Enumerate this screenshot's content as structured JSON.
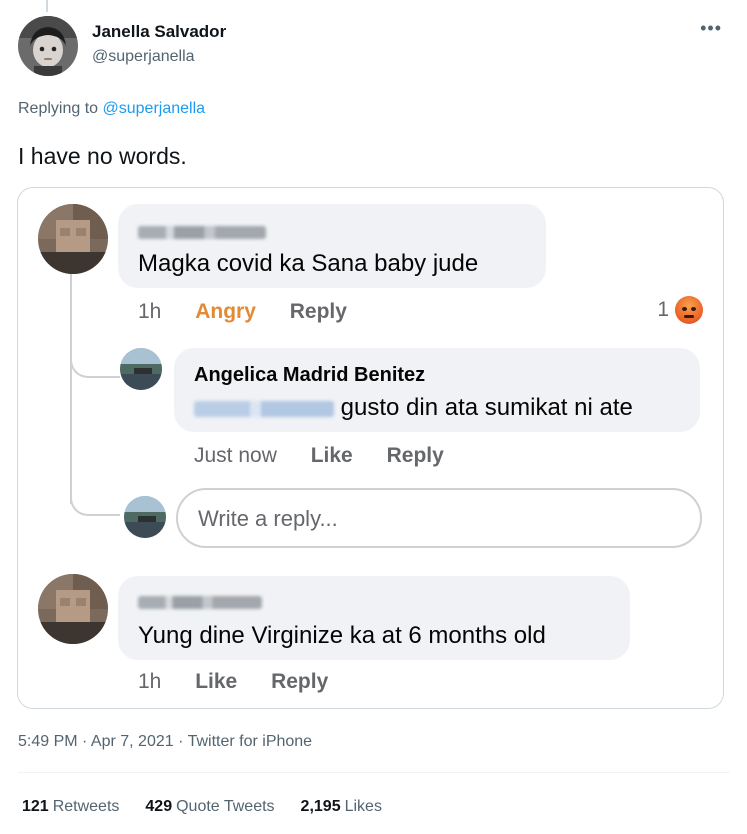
{
  "tweet": {
    "author_name": "Janella Salvador",
    "author_handle": "@superjanella",
    "more_icon": "more-icon",
    "replying_prefix": "Replying to",
    "replying_handle": "@superjanella",
    "text": "I have no words.",
    "timestamp": "5:49 PM · Apr 7, 2021 · Twitter for iPhone",
    "stats": {
      "retweets_count": "121",
      "retweets_label": "Retweets",
      "quote_count": "429",
      "quote_label": "Quote Tweets",
      "likes_count": "2,195",
      "likes_label": "Likes"
    }
  },
  "embedded": {
    "comment1": {
      "text": "Magka covid ka Sana baby jude",
      "time": "1h",
      "reaction": "Angry",
      "reply": "Reply",
      "reaction_count": "1"
    },
    "reply1": {
      "name": "Angelica Madrid Benitez",
      "text": "gusto din ata sumikat ni ate",
      "time": "Just now",
      "like": "Like",
      "reply": "Reply"
    },
    "write_reply_placeholder": "Write a reply...",
    "comment2": {
      "text": "Yung dine Virginize ka at 6 months old",
      "time": "1h",
      "like": "Like",
      "reply": "Reply"
    }
  },
  "colors": {
    "link_blue": "#1d9bf0",
    "angry_orange": "#e28a34",
    "secondary_text": "#536471"
  }
}
